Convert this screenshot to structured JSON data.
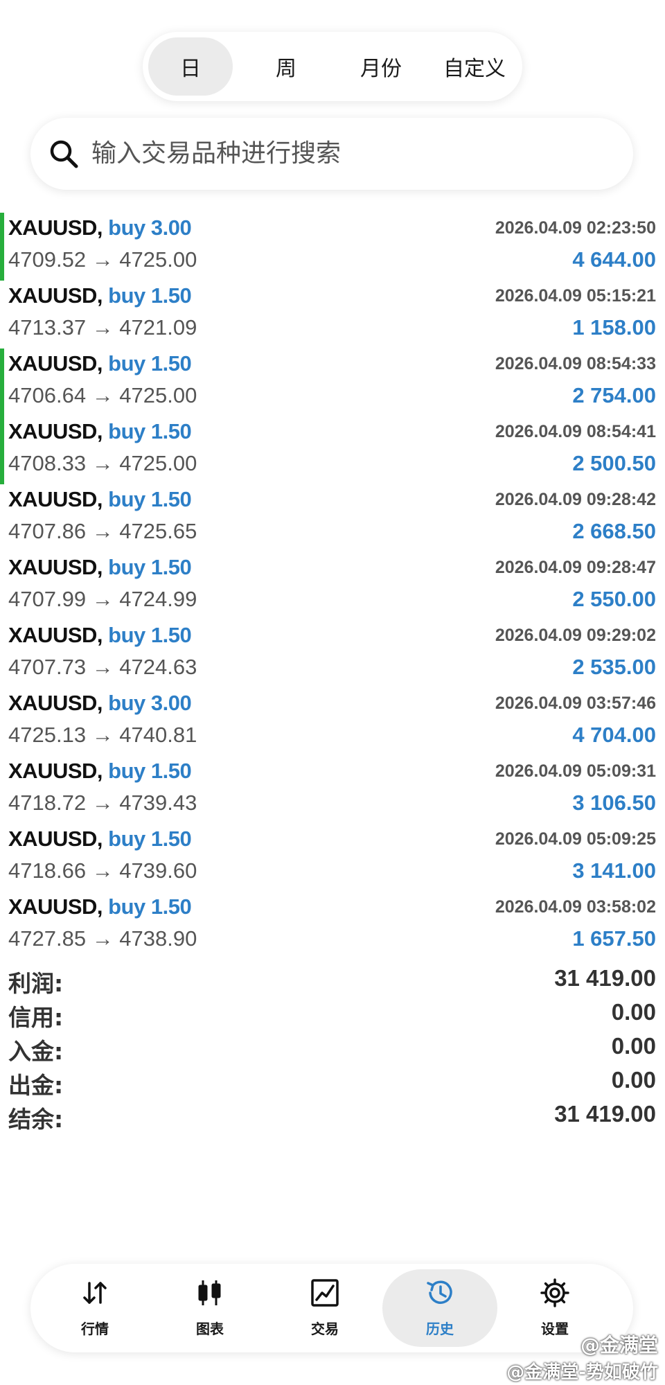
{
  "period_tabs": [
    {
      "label": "日",
      "active": true
    },
    {
      "label": "周",
      "active": false
    },
    {
      "label": "月份",
      "active": false
    },
    {
      "label": "自定义",
      "active": false
    }
  ],
  "search": {
    "placeholder": "输入交易品种进行搜索",
    "icon": "search-icon"
  },
  "trades": [
    {
      "symbol": "XAUUSD,",
      "side": "buy 3.00",
      "time": "2026.04.09 02:23:50",
      "prices": "4709.52 → 4725.00",
      "profit": "4 644.00",
      "marked": true
    },
    {
      "symbol": "XAUUSD,",
      "side": "buy 1.50",
      "time": "2026.04.09 05:15:21",
      "prices": "4713.37 → 4721.09",
      "profit": "1 158.00",
      "marked": false
    },
    {
      "symbol": "XAUUSD,",
      "side": "buy 1.50",
      "time": "2026.04.09 08:54:33",
      "prices": "4706.64 → 4725.00",
      "profit": "2 754.00",
      "marked": true
    },
    {
      "symbol": "XAUUSD,",
      "side": "buy 1.50",
      "time": "2026.04.09 08:54:41",
      "prices": "4708.33 → 4725.00",
      "profit": "2 500.50",
      "marked": true
    },
    {
      "symbol": "XAUUSD,",
      "side": "buy 1.50",
      "time": "2026.04.09 09:28:42",
      "prices": "4707.86 → 4725.65",
      "profit": "2 668.50",
      "marked": false
    },
    {
      "symbol": "XAUUSD,",
      "side": "buy 1.50",
      "time": "2026.04.09 09:28:47",
      "prices": "4707.99 → 4724.99",
      "profit": "2 550.00",
      "marked": false
    },
    {
      "symbol": "XAUUSD,",
      "side": "buy 1.50",
      "time": "2026.04.09 09:29:02",
      "prices": "4707.73 → 4724.63",
      "profit": "2 535.00",
      "marked": false
    },
    {
      "symbol": "XAUUSD,",
      "side": "buy 3.00",
      "time": "2026.04.09 03:57:46",
      "prices": "4725.13 → 4740.81",
      "profit": "4 704.00",
      "marked": false
    },
    {
      "symbol": "XAUUSD,",
      "side": "buy 1.50",
      "time": "2026.04.09 05:09:31",
      "prices": "4718.72 → 4739.43",
      "profit": "3 106.50",
      "marked": false
    },
    {
      "symbol": "XAUUSD,",
      "side": "buy 1.50",
      "time": "2026.04.09 05:09:25",
      "prices": "4718.66 → 4739.60",
      "profit": "3 141.00",
      "marked": false
    },
    {
      "symbol": "XAUUSD,",
      "side": "buy 1.50",
      "time": "2026.04.09 03:58:02",
      "prices": "4727.85 → 4738.90",
      "profit": "1 657.50",
      "marked": false
    }
  ],
  "summary": [
    {
      "label": "利润:",
      "value": "31 419.00"
    },
    {
      "label": "信用:",
      "value": "0.00"
    },
    {
      "label": "入金:",
      "value": "0.00"
    },
    {
      "label": "出金:",
      "value": "0.00"
    },
    {
      "label": "结余:",
      "value": "31 419.00"
    }
  ],
  "nav": [
    {
      "label": "行情",
      "icon": "quotes-arrows-icon",
      "active": false
    },
    {
      "label": "图表",
      "icon": "candlestick-chart-icon",
      "active": false
    },
    {
      "label": "交易",
      "icon": "trade-chart-icon",
      "active": false
    },
    {
      "label": "历史",
      "icon": "history-clock-icon",
      "active": true
    },
    {
      "label": "设置",
      "icon": "gear-icon",
      "active": false
    }
  ],
  "watermark": {
    "line1": "@金满堂",
    "line2": "@金满堂-势如破竹"
  },
  "colors": {
    "accent": "#2d7fc7",
    "marker": "#27ae3c",
    "active_bg": "#ebebeb"
  }
}
